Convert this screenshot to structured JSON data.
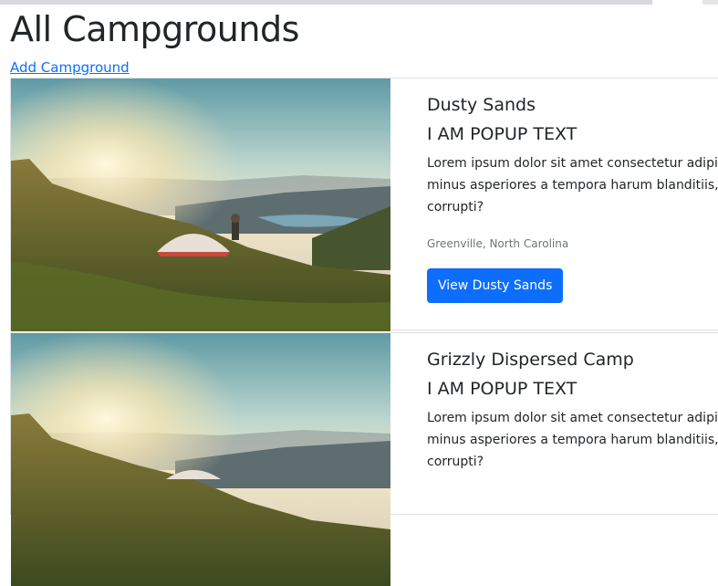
{
  "page": {
    "heading": "All Campgrounds",
    "add_link": "Add Campground"
  },
  "campgrounds": [
    {
      "title": "Dusty Sands",
      "popup": "I AM POPUP TEXT",
      "desc_lines": [
        "Lorem ipsum dolor sit amet consectetur adipi",
        "minus asperiores a tempora harum blanditiis,",
        "corrupti?"
      ],
      "location": "Greenville, North Carolina",
      "button": "View Dusty Sands"
    },
    {
      "title": "Grizzly Dispersed Camp",
      "popup": "I AM POPUP TEXT",
      "desc_lines": [
        "Lorem ipsum dolor sit amet consectetur adipi",
        "minus asperiores a tempora harum blanditiis,",
        "corrupti?"
      ],
      "location": "",
      "button": ""
    }
  ],
  "colors": {
    "link": "#0d6efd",
    "button_bg": "#0d6efd",
    "muted_text": "#6c757d"
  }
}
